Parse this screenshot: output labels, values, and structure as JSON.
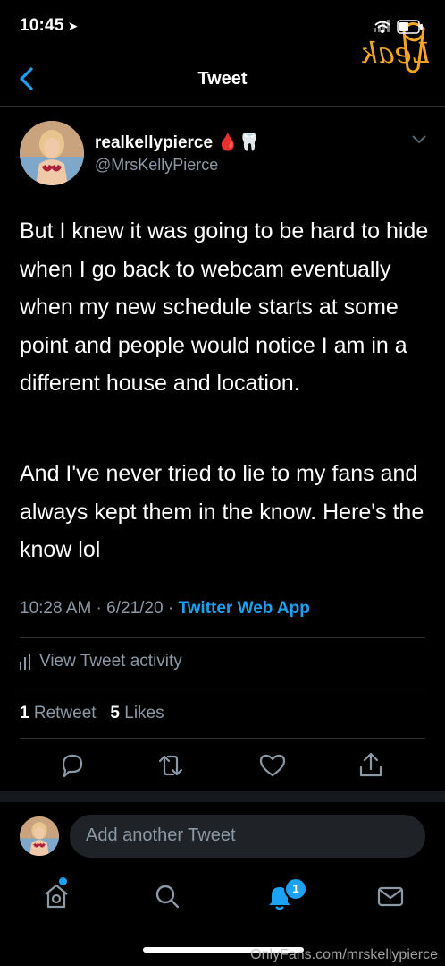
{
  "status_bar": {
    "time": "10:45"
  },
  "watermark_logo": {
    "text": "Hot Leak"
  },
  "header": {
    "title": "Tweet"
  },
  "author": {
    "display_name": "realkellypierce",
    "emoji": "🩸🦷",
    "handle": "@MrsKellyPierce"
  },
  "tweet": {
    "paragraphs": [
      "But I knew it was going to be hard to hide when I go back to webcam eventually when my new schedule starts at some point and people would notice I am in a different house and location.",
      "And I've never tried to lie to my fans and always kept them in the know.  Here's the know lol"
    ],
    "timestamp": "10:28 AM · 6/21/20 · ",
    "source": "Twitter Web App"
  },
  "activity": {
    "label": "View Tweet activity"
  },
  "stats": {
    "retweets_count": "1",
    "retweets_label": "Retweet",
    "likes_count": "5",
    "likes_label": "Likes"
  },
  "composer": {
    "placeholder": "Add another Tweet"
  },
  "tabbar": {
    "notifications_badge": "1"
  },
  "footer": {
    "watermark": "OnlyFans.com/mrskellypierce"
  },
  "colors": {
    "background": "#000000",
    "accent": "#1da1f2",
    "secondary_text": "#8b98a5",
    "divider": "#2f3336"
  }
}
